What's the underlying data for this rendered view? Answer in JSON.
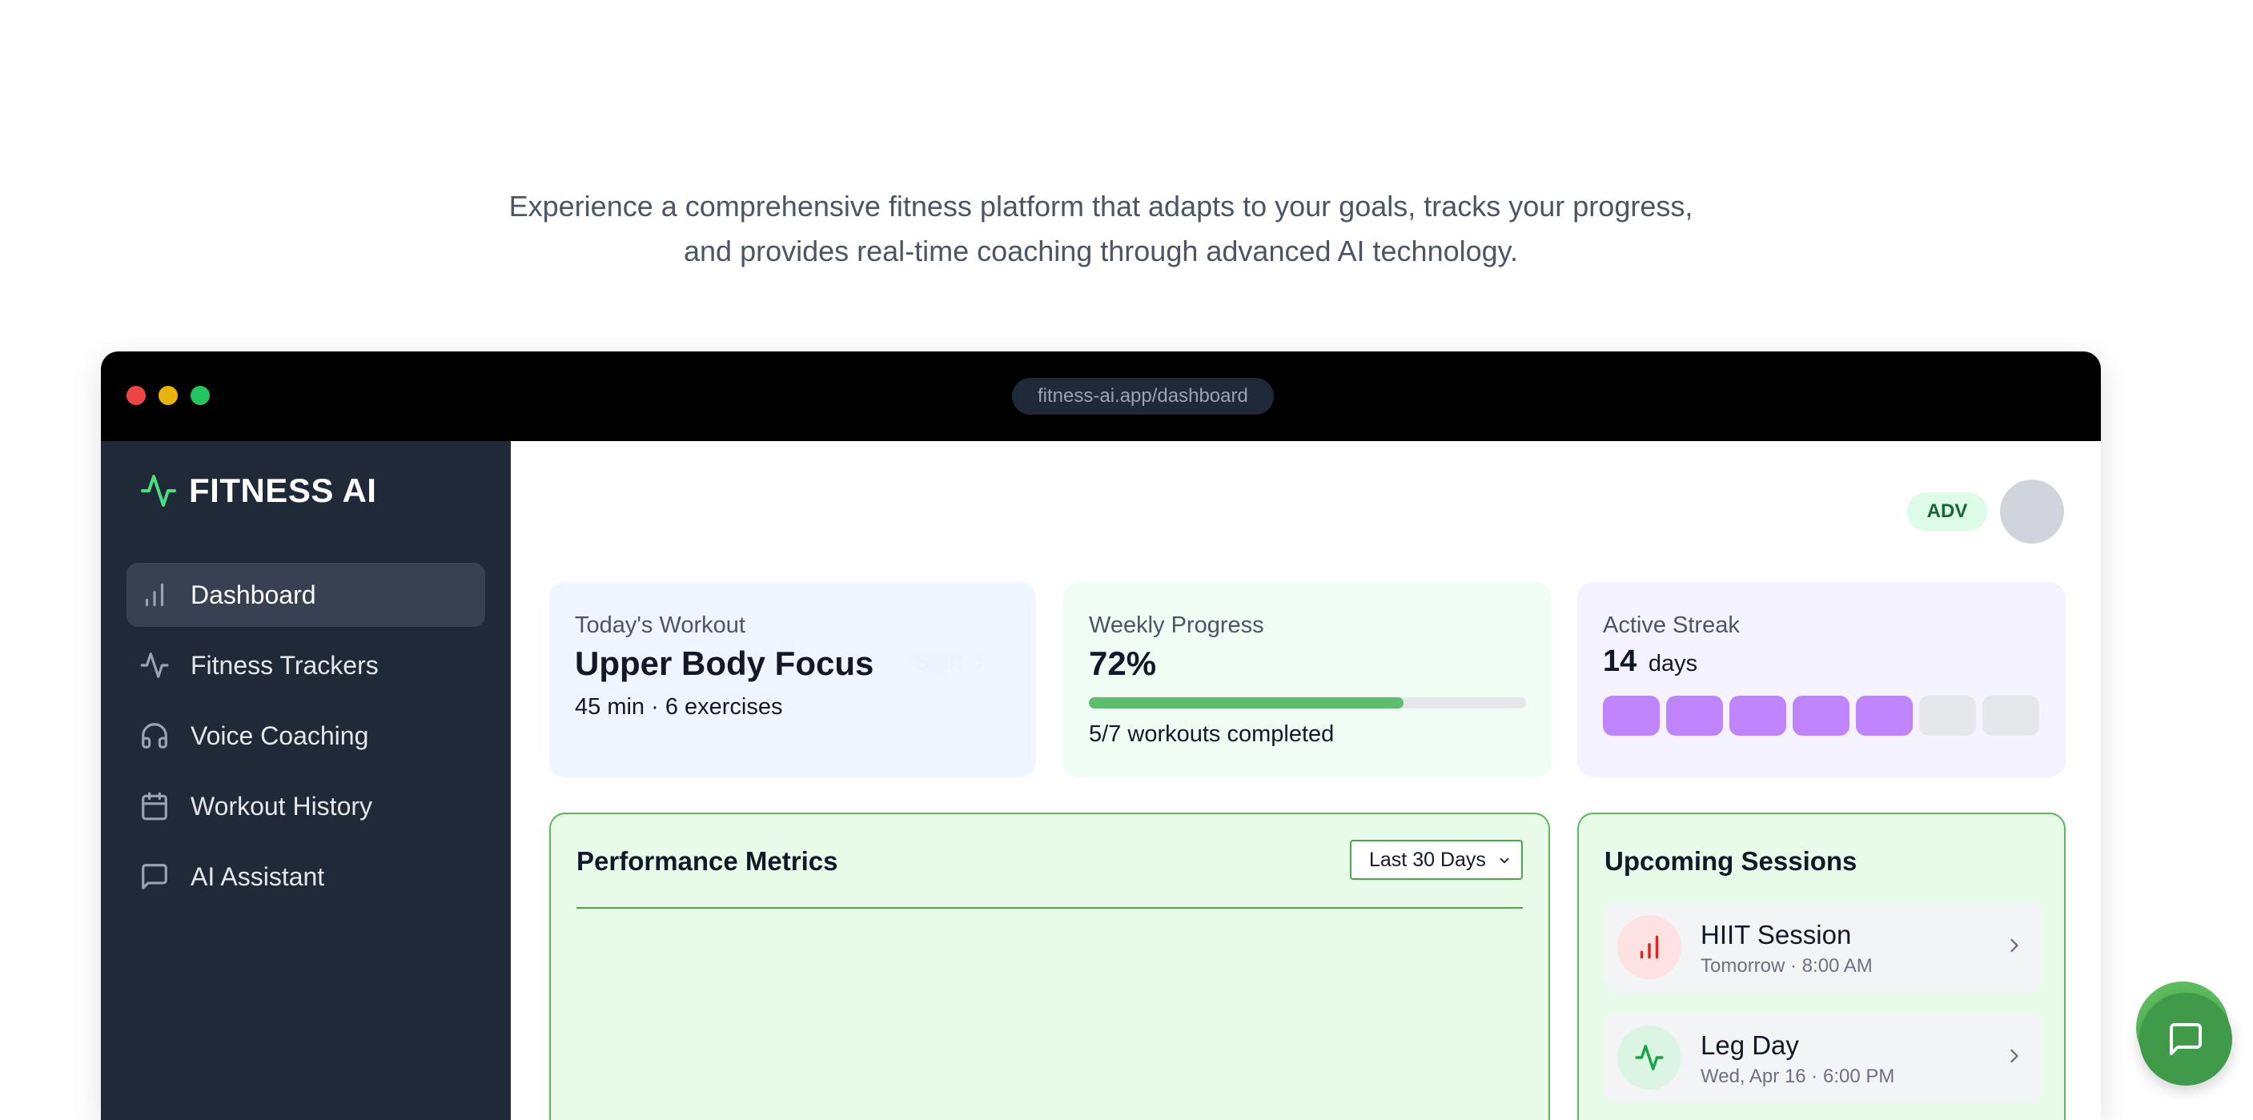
{
  "intro": {
    "line1": "Experience a comprehensive fitness platform that adapts to your goals, tracks your progress,",
    "line2": "and provides real-time coaching through advanced AI technology."
  },
  "browser": {
    "url": "fitness-ai.app/dashboard"
  },
  "sidebar": {
    "brand": "FITNESS AI",
    "brand_icon": "activity-icon",
    "items": [
      {
        "label": "Dashboard",
        "icon": "bar-chart-icon",
        "active": true
      },
      {
        "label": "Fitness Trackers",
        "icon": "activity-icon",
        "active": false
      },
      {
        "label": "Voice Coaching",
        "icon": "headphones-icon",
        "active": false
      },
      {
        "label": "Workout History",
        "icon": "calendar-icon",
        "active": false
      },
      {
        "label": "AI Assistant",
        "icon": "message-square-icon",
        "active": false
      }
    ]
  },
  "header": {
    "badge": "ADV"
  },
  "cards": {
    "workout": {
      "label": "Today's Workout",
      "title": "Upper Body Focus",
      "meta": "45 min · 6 exercises",
      "action": "Start"
    },
    "progress": {
      "label": "Weekly Progress",
      "value": "72%",
      "fraction": 0.72,
      "detail": "5/7 workouts completed"
    },
    "streak": {
      "label": "Active Streak",
      "value": "14",
      "unit": "days",
      "week_active": [
        true,
        true,
        true,
        true,
        true,
        false,
        false
      ]
    }
  },
  "performance": {
    "title": "Performance Metrics",
    "range_selected": "Last 30 Days"
  },
  "sessions": {
    "title": "Upcoming Sessions",
    "items": [
      {
        "name": "HIIT Session",
        "time": "Tomorrow · 8:00 AM",
        "icon": "bar-chart-icon"
      },
      {
        "name": "Leg Day",
        "time": "Wed, Apr 16 · 6:00 PM",
        "icon": "activity-icon"
      }
    ]
  },
  "colors": {
    "accent_green": "#4ade80",
    "sidebar_bg": "#1f2937",
    "streak_on": "#c084fc",
    "streak_off": "#e5e7eb",
    "progress_fill": "#5cbd6b",
    "chat_button": "#3f9a4a"
  }
}
